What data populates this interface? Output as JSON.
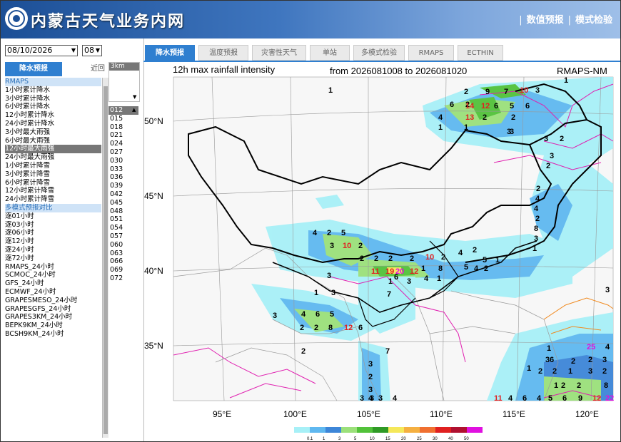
{
  "header": {
    "site_title": "内蒙古天气业务内网",
    "nav": [
      "数值预报",
      "模式检验"
    ]
  },
  "controls": {
    "date_value": "08/10/2026",
    "hour_value": "08"
  },
  "left_tabs": {
    "active": "降水预报",
    "recent": "近回"
  },
  "product_list": [
    {
      "label": "RMAPS",
      "type": "group"
    },
    {
      "label": "1小时累计降水",
      "type": "item"
    },
    {
      "label": "3小时累计降水",
      "type": "item"
    },
    {
      "label": "6小时累计降水",
      "type": "item"
    },
    {
      "label": "12小时累计降水",
      "type": "item"
    },
    {
      "label": "24小时累计降水",
      "type": "item"
    },
    {
      "label": "3小时最大雨强",
      "type": "item"
    },
    {
      "label": "6小时最大雨强",
      "type": "item"
    },
    {
      "label": "12小时最大雨强",
      "type": "selected"
    },
    {
      "label": "24小时最大雨强",
      "type": "item"
    },
    {
      "label": "1小时累计降雪",
      "type": "item"
    },
    {
      "label": "3小时累计降雪",
      "type": "item"
    },
    {
      "label": "6小时累计降雪",
      "type": "item"
    },
    {
      "label": "12小时累计降雪",
      "type": "item"
    },
    {
      "label": "24小时累计降雪",
      "type": "item"
    },
    {
      "label": "多模式预报对比",
      "type": "group"
    },
    {
      "label": "逐01小时",
      "type": "item"
    },
    {
      "label": "逐03小时",
      "type": "item"
    },
    {
      "label": "逐06小时",
      "type": "item"
    },
    {
      "label": "逐12小时",
      "type": "item"
    },
    {
      "label": "逐24小时",
      "type": "item"
    },
    {
      "label": "逐72小时",
      "type": "item"
    },
    {
      "label": "RMAPS_24小时",
      "type": "item"
    },
    {
      "label": "SCMOC_24小时",
      "type": "item"
    },
    {
      "label": "GFS_24小时",
      "type": "item"
    },
    {
      "label": "ECMWF_24小时",
      "type": "item"
    },
    {
      "label": "GRAPESMESO_24小时",
      "type": "item"
    },
    {
      "label": "GRAPESGFS_24小时",
      "type": "item"
    },
    {
      "label": "GRAPES3KM_24小时",
      "type": "item"
    },
    {
      "label": "BEPK9KM_24小时",
      "type": "item"
    },
    {
      "label": "BCSH9KM_24小时",
      "type": "item"
    }
  ],
  "level_box": {
    "header": "3km"
  },
  "lead_times": [
    "012",
    "015",
    "018",
    "021",
    "024",
    "027",
    "030",
    "033",
    "036",
    "039",
    "042",
    "045",
    "048",
    "051",
    "054",
    "057",
    "060",
    "063",
    "066",
    "069",
    "072"
  ],
  "lead_selected": "012",
  "top_tabs": [
    "降水预报",
    "温度预报",
    "灾害性天气",
    "单站",
    "多模式检验",
    "RMAPS",
    "ECTHIN"
  ],
  "top_tab_active": "降水预报",
  "map": {
    "title_left": "12h max rainfall intensity",
    "title_mid": "from 2026081008 to 2026081020",
    "title_right": "RMAPS-NM",
    "lat_labels": [
      "50°N",
      "45°N",
      "40°N",
      "35°N"
    ],
    "lon_labels": [
      "95°E",
      "100°E",
      "105°E",
      "110°E",
      "115°E",
      "120°E"
    ],
    "legend_ticks": [
      "0.1",
      "1",
      "3",
      "5",
      "10",
      "15",
      "20",
      "25",
      "30",
      "40",
      "50"
    ],
    "legend_colors": [
      "#a7f0f7",
      "#5fb8f0",
      "#3d86d8",
      "#9be07a",
      "#52c23a",
      "#2f9a26",
      "#f5e85a",
      "#f5b041",
      "#f07030",
      "#e02020",
      "#b01030",
      "#e010e0"
    ],
    "numbers": [
      {
        "v": "1"
      },
      {
        "v": "2"
      },
      {
        "v": "9"
      },
      {
        "v": "7"
      },
      {
        "v": "10"
      },
      {
        "v": "3"
      },
      {
        "v": "1"
      },
      {
        "v": "2"
      },
      {
        "v": "6"
      },
      {
        "v": "14"
      },
      {
        "v": "12"
      },
      {
        "v": "6"
      },
      {
        "v": "5"
      },
      {
        "v": "6"
      },
      {
        "v": "4"
      },
      {
        "v": "13"
      },
      {
        "v": "2"
      },
      {
        "v": "2"
      },
      {
        "v": "1"
      },
      {
        "v": "1"
      },
      {
        "v": "3"
      },
      {
        "v": "2"
      },
      {
        "v": "3"
      },
      {
        "v": "2"
      },
      {
        "v": "2"
      },
      {
        "v": "4"
      },
      {
        "v": "4"
      },
      {
        "v": "2"
      },
      {
        "v": "8"
      },
      {
        "v": "3"
      },
      {
        "v": "1"
      },
      {
        "v": "4"
      },
      {
        "v": "2"
      },
      {
        "v": "5"
      },
      {
        "v": "3"
      },
      {
        "v": "10"
      },
      {
        "v": "2"
      },
      {
        "v": "2"
      },
      {
        "v": "2"
      },
      {
        "v": "2"
      },
      {
        "v": "2"
      },
      {
        "v": "10"
      },
      {
        "v": "2"
      },
      {
        "v": "4"
      },
      {
        "v": "2"
      },
      {
        "v": "5"
      },
      {
        "v": "1"
      },
      {
        "v": "11"
      },
      {
        "v": "19"
      },
      {
        "v": "20"
      },
      {
        "v": "12"
      },
      {
        "v": "1"
      },
      {
        "v": "8"
      },
      {
        "v": "5"
      },
      {
        "v": "4"
      },
      {
        "v": "2"
      },
      {
        "v": "3"
      },
      {
        "v": "6"
      },
      {
        "v": "3"
      },
      {
        "v": "4"
      },
      {
        "v": "1"
      },
      {
        "v": "1"
      },
      {
        "v": "3"
      },
      {
        "v": "1"
      },
      {
        "v": "7"
      },
      {
        "v": "3"
      },
      {
        "v": "4"
      },
      {
        "v": "6"
      },
      {
        "v": "5"
      },
      {
        "v": "2"
      },
      {
        "v": "2"
      },
      {
        "v": "8"
      },
      {
        "v": "12"
      },
      {
        "v": "6"
      },
      {
        "v": "2"
      },
      {
        "v": "7"
      },
      {
        "v": "3"
      },
      {
        "v": "2"
      },
      {
        "v": "3"
      },
      {
        "v": "3"
      },
      {
        "v": "4"
      },
      {
        "v": "1"
      },
      {
        "v": "3"
      },
      {
        "v": "1"
      },
      {
        "v": "2"
      },
      {
        "v": "2"
      },
      {
        "v": "1"
      },
      {
        "v": "3"
      },
      {
        "v": "2"
      },
      {
        "v": "6"
      },
      {
        "v": "2"
      },
      {
        "v": "2"
      },
      {
        "v": "3"
      },
      {
        "v": "1"
      },
      {
        "v": "2"
      },
      {
        "v": "2"
      },
      {
        "v": "8"
      },
      {
        "v": "11"
      },
      {
        "v": "4"
      },
      {
        "v": "6"
      },
      {
        "v": "4"
      },
      {
        "v": "5"
      },
      {
        "v": "6"
      },
      {
        "v": "9"
      },
      {
        "v": "12"
      },
      {
        "v": "22"
      },
      {
        "v": "25"
      },
      {
        "v": "4"
      },
      {
        "v": "3"
      },
      {
        "v": "3"
      },
      {
        "v": "4"
      },
      {
        "v": "3"
      },
      {
        "v": "3"
      },
      {
        "v": "3"
      }
    ]
  }
}
